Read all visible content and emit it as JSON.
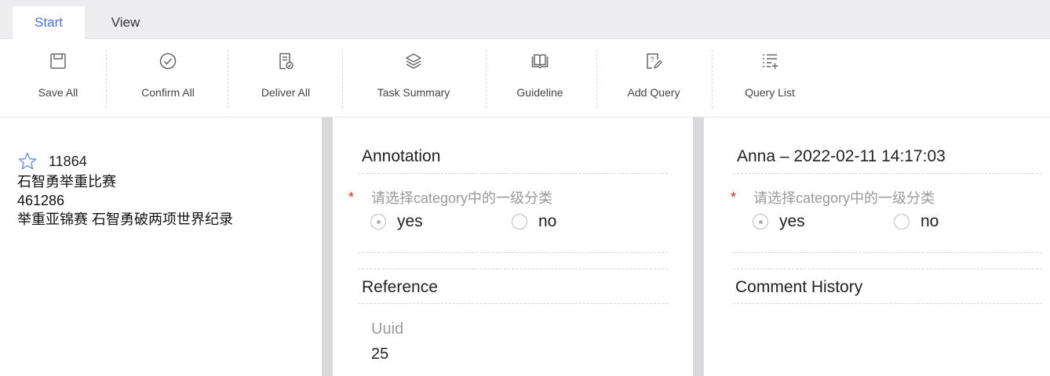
{
  "tabs": [
    {
      "label": "Start"
    },
    {
      "label": "View"
    }
  ],
  "toolbar": {
    "items": [
      {
        "label": "Save All",
        "icon": "save-icon"
      },
      {
        "label": "Confirm All",
        "icon": "check-circle-icon"
      },
      {
        "label": "Deliver All",
        "icon": "deliver-document-icon"
      },
      {
        "label": "Task Summary",
        "icon": "layers-icon"
      },
      {
        "label": "Guideline",
        "icon": "book-icon"
      },
      {
        "label": "Add Query",
        "icon": "add-query-icon"
      },
      {
        "label": "Query List",
        "icon": "list-icon"
      }
    ]
  },
  "left": {
    "id": "11864",
    "title": "石智勇举重比赛",
    "number": "461286",
    "headline": "举重亚锦赛 石智勇破两项世界纪录"
  },
  "annotation": {
    "title": "Annotation",
    "required_mark": "*",
    "question": "请选择category中的一级分类",
    "options": [
      "yes",
      "no"
    ],
    "selected": "yes"
  },
  "reference": {
    "title": "Reference",
    "field_label": "Uuid",
    "field_value": "25"
  },
  "history": {
    "header": "Anna – 2022-02-11 14:17:03",
    "required_mark": "*",
    "question": "请选择category中的一级分类",
    "options": [
      "yes",
      "no"
    ],
    "selected": "yes",
    "comment_title": "Comment History"
  },
  "colors": {
    "accent": "#4a6ee0",
    "required": "#d52b2b",
    "tabbar": "#ededef",
    "column_gap": "#d9d9dc"
  }
}
